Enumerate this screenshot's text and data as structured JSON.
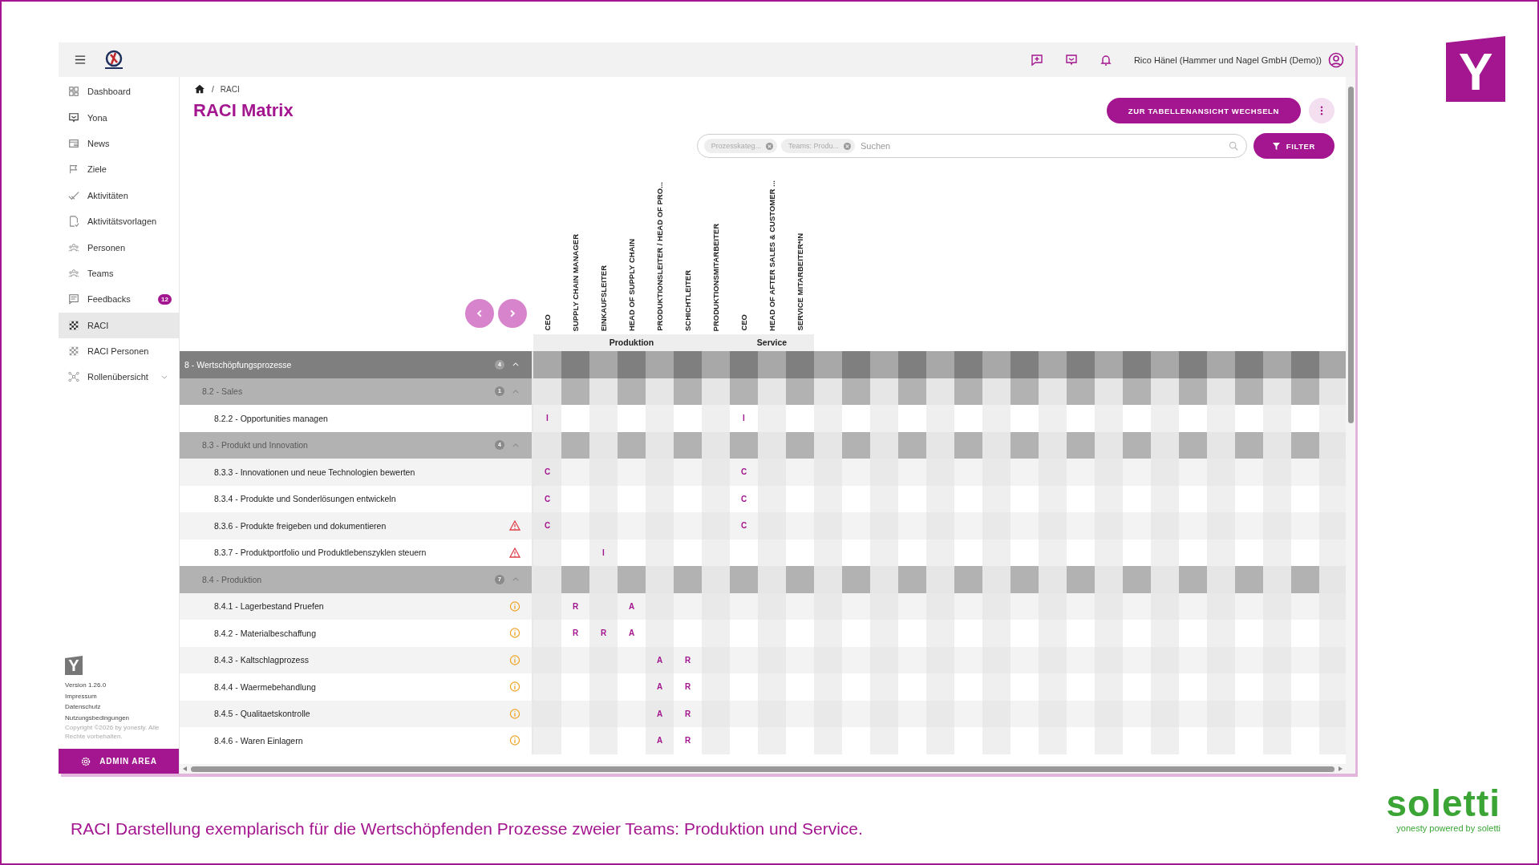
{
  "slide": {
    "logo": "Y",
    "caption": "RACI Darstellung exemplarisch für die Wertschöpfenden Prozesse zweier Teams: Produktion und Service.",
    "brand": "soletti",
    "tagline": "yonesty powered by soletti"
  },
  "topbar": {
    "user": "Rico Hänel (Hammer und Nagel GmbH (Demo))"
  },
  "sidebar": {
    "items": [
      {
        "label": "Dashboard",
        "selected": false
      },
      {
        "label": "Yona",
        "selected": false
      },
      {
        "label": "News",
        "selected": false
      },
      {
        "label": "Ziele",
        "selected": false
      },
      {
        "label": "Aktivitäten",
        "selected": false
      },
      {
        "label": "Aktivitätsvorlagen",
        "selected": false
      },
      {
        "label": "Personen",
        "selected": false
      },
      {
        "label": "Teams",
        "selected": false
      },
      {
        "label": "Feedbacks",
        "selected": false,
        "badge": "12"
      },
      {
        "label": "RACI",
        "selected": true
      },
      {
        "label": "RACI Personen",
        "selected": false
      },
      {
        "label": "Rollenübersicht",
        "selected": false,
        "expandable": true
      }
    ],
    "logo": "Y",
    "footer": [
      "Version 1.26.0",
      "Impressum",
      "Datenschutz",
      "Nutzungsbedingungen"
    ],
    "copyright": "Copyright ©2026 by yonesty. Alle Rechte vorbehalten.",
    "admin_button": "ADMIN AREA"
  },
  "breadcrumb": [
    "RACI"
  ],
  "breadcrumb_separator": "/",
  "title": "RACI Matrix",
  "switch_button": "ZUR TABELLENANSICHT WECHSELN",
  "search": {
    "chips": [
      "Prozesskateg...",
      "Teams: Produ..."
    ],
    "placeholder": "Suchen"
  },
  "filter_button": "FILTER",
  "teams": [
    {
      "name": "Produktion",
      "columns": [
        "CEO",
        "SUPPLY CHAIN MANAGER",
        "EINKAUFSLEITER",
        "HEAD OF SUPPLY CHAIN",
        "PRODUKTIONSLEITER / HEAD OF PRO...",
        "SCHICHTLEITER",
        "PRODUKTIONSMITARBEITER"
      ]
    },
    {
      "name": "Service",
      "columns": [
        "CEO",
        "HEAD OF AFTER SALES & CUSTOMER ...",
        "SERVICE MITARBEITER*IN"
      ]
    }
  ],
  "processes": [
    {
      "label": "8 - Wertschöpfungsprozesse",
      "count": "4",
      "expanded": true,
      "children": [
        {
          "label": "8.2 - Sales",
          "count": "1",
          "expanded": true,
          "children": [
            {
              "label": "8.2.2 - Opportunities managen",
              "cells": [
                "I",
                null,
                null,
                null,
                null,
                null,
                null,
                "I",
                null,
                null
              ]
            }
          ]
        },
        {
          "label": "8.3 - Produkt und Innovation",
          "count": "4",
          "expanded": true,
          "children": [
            {
              "label": "8.3.3 - Innovationen und neue Technologien bewerten",
              "cells": [
                "C",
                null,
                null,
                null,
                null,
                null,
                null,
                "C",
                null,
                null
              ]
            },
            {
              "label": "8.3.4 - Produkte und Sonderlösungen entwickeln",
              "cells": [
                "C",
                null,
                null,
                null,
                null,
                null,
                null,
                "C",
                null,
                null
              ]
            },
            {
              "label": "8.3.6 - Produkte freigeben und dokumentieren",
              "kind": "warning",
              "cells": [
                "C",
                null,
                null,
                null,
                null,
                null,
                null,
                "C",
                null,
                null
              ]
            },
            {
              "label": "8.3.7 - Produktportfolio und Produktlebenszyklen steuern",
              "kind": "warning",
              "cells": [
                null,
                null,
                "I",
                null,
                null,
                null,
                null,
                null,
                null,
                null
              ]
            }
          ]
        },
        {
          "label": "8.4 - Produktion",
          "count": "7",
          "expanded": true,
          "children": [
            {
              "label": "8.4.1 - Lagerbestand Pruefen",
              "kind": "info",
              "cells": [
                null,
                "R",
                null,
                "A",
                null,
                null,
                null,
                null,
                null,
                null
              ]
            },
            {
              "label": "8.4.2 - Materialbeschaffung",
              "kind": "info",
              "cells": [
                null,
                "R",
                "R",
                "A",
                null,
                null,
                null,
                null,
                null,
                null
              ]
            },
            {
              "label": "8.4.3 - Kaltschlagprozess",
              "kind": "info",
              "cells": [
                null,
                null,
                null,
                null,
                "A",
                "R",
                null,
                null,
                null,
                null
              ]
            },
            {
              "label": "8.4.4 - Waermebehandlung",
              "kind": "info",
              "cells": [
                null,
                null,
                null,
                null,
                "A",
                "R",
                null,
                null,
                null,
                null
              ]
            },
            {
              "label": "8.4.5 - Qualitaetskontrolle",
              "kind": "info",
              "cells": [
                null,
                null,
                null,
                null,
                "A",
                "R",
                null,
                null,
                null,
                null
              ]
            },
            {
              "label": "8.4.6 - Waren Einlagern",
              "kind": "info",
              "cells": [
                null,
                null,
                null,
                null,
                "A",
                "R",
                null,
                null,
                null,
                null
              ]
            }
          ]
        }
      ]
    }
  ]
}
